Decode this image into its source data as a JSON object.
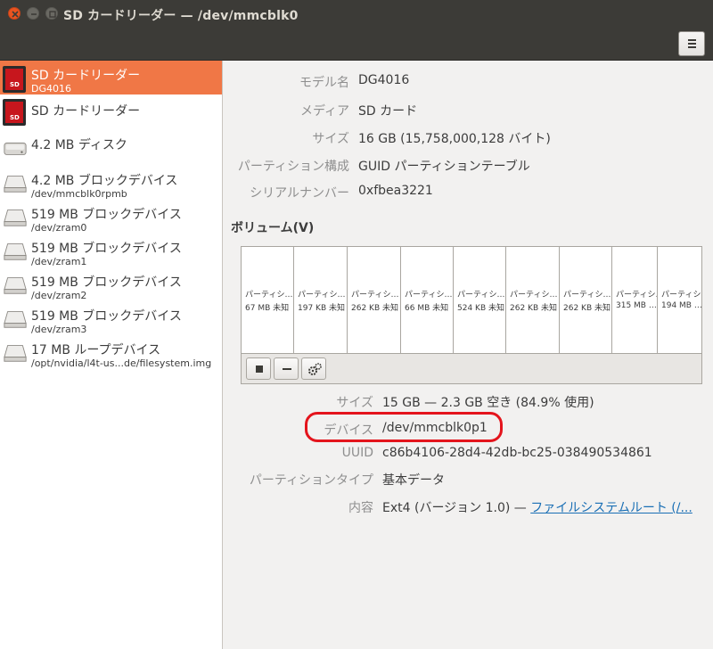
{
  "window": {
    "title": "SD カードリーダー — /dev/mmcblk0"
  },
  "header": {
    "menu_icon": "hamburger-icon"
  },
  "sidebar": {
    "items": [
      {
        "icon": "sd-card-icon",
        "title": "SD カードリーダー",
        "subtitle": "DG4016",
        "selected": true
      },
      {
        "icon": "sd-card-icon",
        "title": "SD カードリーダー",
        "subtitle": ""
      },
      {
        "icon": "disk-icon",
        "title": "4.2 MB ディスク",
        "subtitle": ""
      },
      {
        "icon": "block-device-icon",
        "title": "4.2 MB ブロックデバイス",
        "subtitle": "/dev/mmcblk0rpmb"
      },
      {
        "icon": "block-device-icon",
        "title": "519 MB ブロックデバイス",
        "subtitle": "/dev/zram0"
      },
      {
        "icon": "block-device-icon",
        "title": "519 MB ブロックデバイス",
        "subtitle": "/dev/zram1"
      },
      {
        "icon": "block-device-icon",
        "title": "519 MB ブロックデバイス",
        "subtitle": "/dev/zram2"
      },
      {
        "icon": "block-device-icon",
        "title": "519 MB ブロックデバイス",
        "subtitle": "/dev/zram3"
      },
      {
        "icon": "block-device-icon",
        "title": "17 MB ループデバイス",
        "subtitle": "/opt/nvidia/l4t-us...de/filesystem.img"
      }
    ]
  },
  "drive": {
    "model_label": "モデル名",
    "model": "DG4016",
    "media_label": "メディア",
    "media": "SD カード",
    "size_label": "サイズ",
    "size": "16 GB (15,758,000,128 バイト)",
    "partitioning_label": "パーティション構成",
    "partitioning": "GUID パーティションテーブル",
    "serial_label": "シリアルナンバー",
    "serial": "0xfbea3221"
  },
  "volumes": {
    "heading": "ボリューム(V)",
    "segments": [
      {
        "name": "パーティシ…",
        "size": "67 MB 未知"
      },
      {
        "name": "パーティシ…",
        "size": "197 KB 未知"
      },
      {
        "name": "パーティシ…",
        "size": "262 KB 未知"
      },
      {
        "name": "パーティシ…",
        "size": "66 MB 未知"
      },
      {
        "name": "パーティシ…",
        "size": "524 KB 未知"
      },
      {
        "name": "パーティシ…",
        "size": "262 KB 未知"
      },
      {
        "name": "パーティシ…",
        "size": "262 KB 未知"
      },
      {
        "name": "パーティシ…",
        "size": "315 MB …"
      },
      {
        "name": "パーティシ…",
        "size": "194 MB …"
      }
    ],
    "toolbar": {
      "stop_icon": "stop-icon",
      "delete_icon": "minus-icon",
      "options_icon": "gears-icon"
    }
  },
  "partition": {
    "size_label": "サイズ",
    "size": "15 GB — 2.3 GB 空き (84.9% 使用)",
    "device_label": "デバイス",
    "device": "/dev/mmcblk0p1",
    "uuid_label": "UUID",
    "uuid": "c86b4106-28d4-42db-bc25-038490534861",
    "type_label": "パーティションタイプ",
    "type": "基本データ",
    "contents_label": "内容",
    "contents_prefix": "Ext4 (バージョン 1.0) — ",
    "contents_link": "ファイルシステムルート (/..."
  },
  "colors": {
    "titlebar": "#3c3b37",
    "selection": "#f07746",
    "close_button": "#e95420",
    "highlight_ring": "#e4141c",
    "link": "#1a6fb5"
  }
}
